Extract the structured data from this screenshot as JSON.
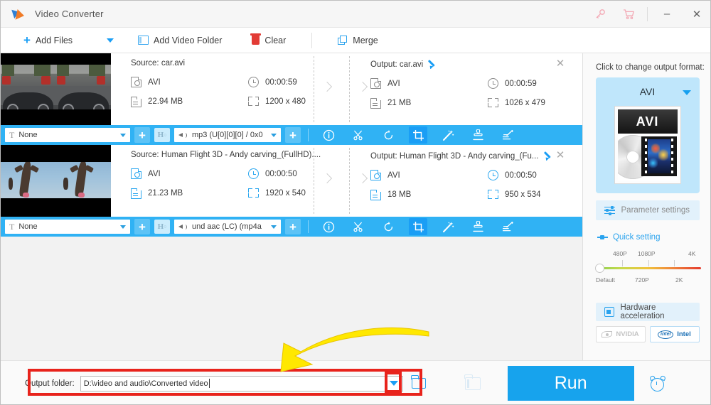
{
  "window": {
    "title": "Video Converter",
    "icons": {
      "key": "key-icon",
      "cart": "cart-icon",
      "minimize": "minimize-icon",
      "close": "close-icon"
    },
    "minimize_glyph": "–",
    "close_glyph": "✕",
    "key_glyph": "⚷",
    "cart_glyph": "🛒"
  },
  "toolbar": {
    "add_files": "Add Files",
    "add_video_folder": "Add Video Folder",
    "clear": "Clear",
    "merge": "Merge"
  },
  "files": [
    {
      "source_label": "Source: car.avi",
      "source_format": "AVI",
      "source_duration": "00:00:59",
      "source_size": "22.94 MB",
      "source_resolution": "1200 x 480",
      "output_label": "Output: car.avi",
      "output_format": "AVI",
      "output_duration": "00:00:59",
      "output_size": "21 MB",
      "output_resolution": "1026 x 479",
      "subtitle_track": "None",
      "audio_track": "mp3 (U[0][0][0] / 0x0",
      "hdr_label": "H"
    },
    {
      "source_label": "Source: Human Flight 3D - Andy carving_(FullHD)....",
      "source_format": "AVI",
      "source_duration": "00:00:50",
      "source_size": "21.23 MB",
      "source_resolution": "1920 x 540",
      "output_label": "Output: Human Flight 3D - Andy carving_(Fu...",
      "output_format": "AVI",
      "output_duration": "00:00:50",
      "output_size": "18 MB",
      "output_resolution": "950 x 534",
      "subtitle_track": "None",
      "audio_track": "und aac (LC) (mp4a",
      "hdr_label": "H"
    }
  ],
  "row_tools": [
    {
      "name": "info-icon",
      "active": false
    },
    {
      "name": "cut-scissors-icon",
      "active": false
    },
    {
      "name": "rotate-icon",
      "active": false
    },
    {
      "name": "crop-icon",
      "active": true
    },
    {
      "name": "effects-wand-icon",
      "active": false
    },
    {
      "name": "watermark-stamp-icon",
      "active": false
    },
    {
      "name": "subtitle-edit-icon",
      "active": false
    }
  ],
  "right_panel": {
    "hint": "Click to change output format:",
    "format_name": "AVI",
    "format_badge": "AVI",
    "parameter_settings": "Parameter settings",
    "quick_setting": "Quick setting",
    "slider": {
      "top_labels": [
        "480P",
        "1080P",
        "4K"
      ],
      "bottom_labels": [
        "Default",
        "720P",
        "2K"
      ],
      "value": "Default"
    },
    "hardware_acceleration": "Hardware acceleration",
    "gpu_nvidia": "NVIDIA",
    "gpu_intel": "Intel",
    "gpu_intel_mark": "intel"
  },
  "bottom": {
    "output_folder_label": "Output folder:",
    "output_folder_value": "D:\\video and audio\\Converted video",
    "run_label": "Run",
    "icons": {
      "dropdown": "chevron-down-icon",
      "browse": "folder-icon",
      "open_output": "open-output-folder-icon",
      "schedule": "alarm-clock-icon"
    }
  },
  "colors": {
    "accent_blue": "#17a3ed",
    "bar_blue": "#30b2f4",
    "annotation_red": "#e8231c",
    "annotation_yellow": "#ffe800",
    "panel_bg": "#fafafa"
  }
}
